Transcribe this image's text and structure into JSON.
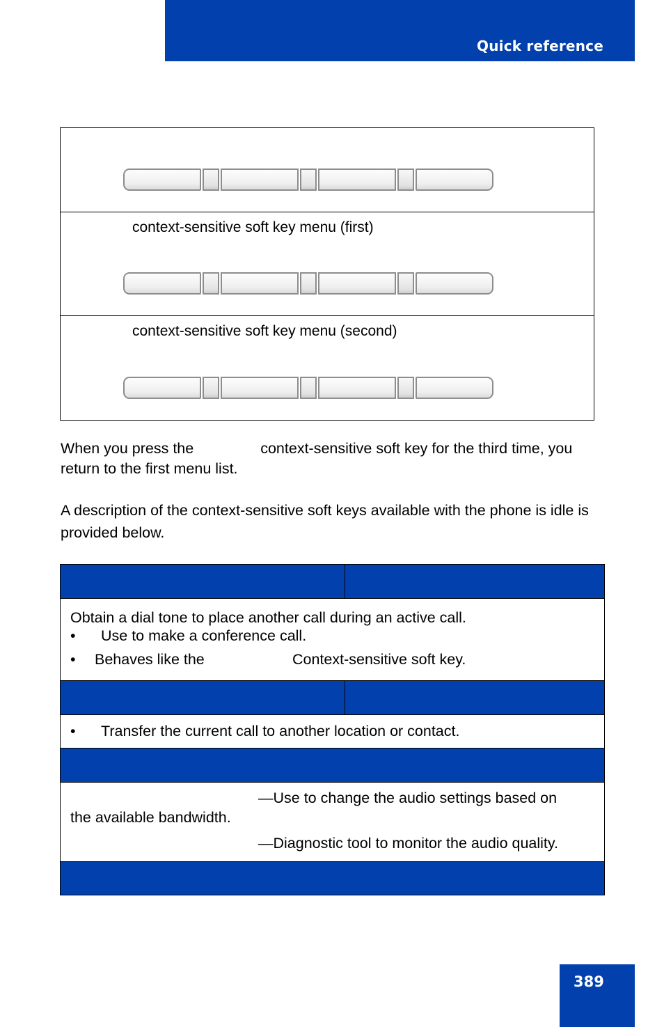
{
  "header": {
    "section_title": "Quick reference",
    "brand_color": "#0241ad"
  },
  "menu_table": {
    "rows": [
      {
        "caption": ""
      },
      {
        "caption": "context-sensitive soft key menu (first)"
      },
      {
        "caption": "context-sensitive soft key menu (second)"
      }
    ],
    "softkey_icon": "softkey-bar-graphic"
  },
  "paragraphs": {
    "p1_before": "When you press the",
    "p1_after": "context-sensitive soft key for the third time, you return to the first menu list.",
    "p2": "A description of the context-sensitive soft keys available with the phone is idle is provided below."
  },
  "desc_table": {
    "row1": {
      "line1": "Obtain a dial tone to place another call during an active call.",
      "bullet1": "Use to make a conference call.",
      "bullet2_before": "Behaves like the",
      "bullet2_after": "Context-sensitive soft key."
    },
    "row2": {
      "bullet1": "Transfer the current call to another location or contact."
    },
    "row3": {
      "item1_text": "—Use to change the audio settings based on",
      "item1_cont": "the available bandwidth.",
      "item2_text": "—Diagnostic tool to monitor the audio quality."
    },
    "bullet_char": "•"
  },
  "footer": {
    "page_number": "389"
  }
}
